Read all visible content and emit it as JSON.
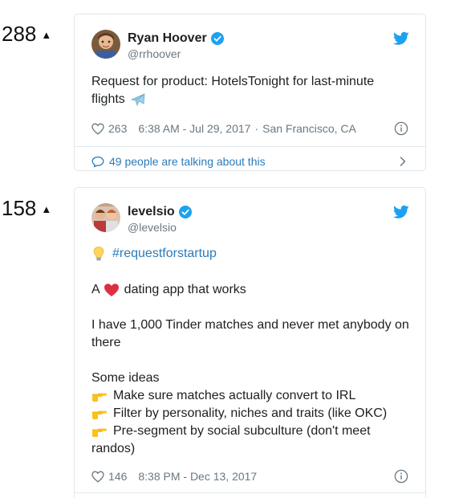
{
  "posts": [
    {
      "votes": "288",
      "tweet": {
        "name": "Ryan Hoover",
        "handle": "@rrhoover",
        "text_line1": "Request for product: HotelsTonight for last-minute",
        "text_line2": "flights",
        "likes": "263",
        "time": "6:38 AM - Jul 29, 2017",
        "separator": "·",
        "location": "San Francisco, CA",
        "talking": "49 people are talking about this"
      }
    },
    {
      "votes": "158",
      "tweet": {
        "name": "levelsio",
        "handle": "@levelsio",
        "hashtag": "#requestforstartup",
        "line_a": "A",
        "line_a_rest": "dating app that works",
        "line_b1": "I have 1,000 Tinder matches and never met anybody on",
        "line_b2": "there",
        "ideas_title": "Some ideas",
        "idea1": "Make sure matches actually convert to IRL",
        "idea2": "Filter by personality, niches and traits (like OKC)",
        "idea3a": "Pre-segment by social subculture (don't meet",
        "idea3b": "randos)",
        "likes": "146",
        "time": "8:38 PM - Dec 13, 2017"
      }
    }
  ],
  "icons": {
    "upvote": "triangle-up",
    "verified": "verified-badge",
    "bird": "twitter-bird",
    "heart": "heart-outline",
    "info": "info-circle",
    "bubble": "speech-bubble",
    "chevron": "chevron-right",
    "airplane": "airplane-emoji",
    "bulb": "lightbulb-emoji",
    "red_heart": "red-heart-emoji",
    "pointing": "pointing-hand-emoji"
  },
  "colors": {
    "twitter_blue": "#1da1f2",
    "link_blue": "#2b7bb9",
    "meta_gray": "#697882",
    "border": "#e1e8ed"
  }
}
